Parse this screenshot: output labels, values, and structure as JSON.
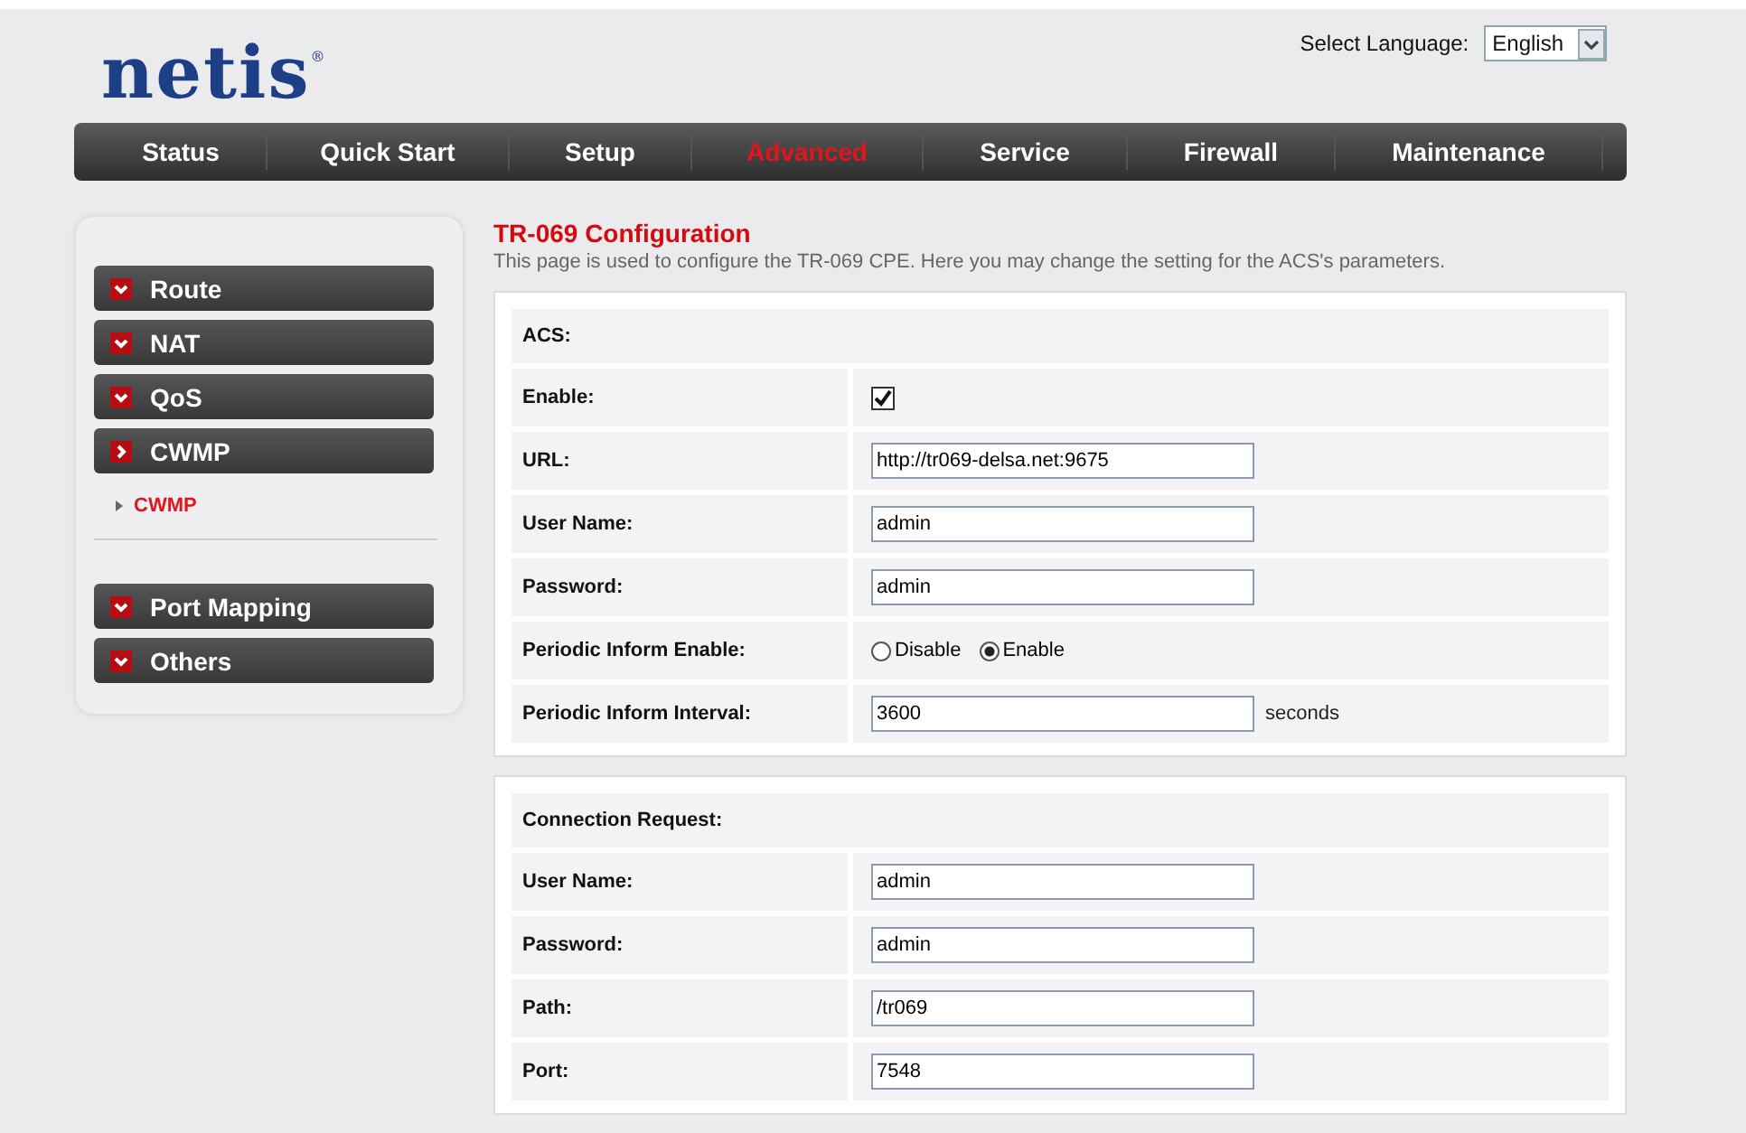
{
  "logo": "netis",
  "logo_mark": "®",
  "language": {
    "label": "Select Language:",
    "value": "English"
  },
  "nav": [
    {
      "label": "Status",
      "selected": false
    },
    {
      "label": "Quick Start",
      "selected": false
    },
    {
      "label": "Setup",
      "selected": false
    },
    {
      "label": "Advanced",
      "selected": true
    },
    {
      "label": "Service",
      "selected": false
    },
    {
      "label": "Firewall",
      "selected": false
    },
    {
      "label": "Maintenance",
      "selected": false
    }
  ],
  "sidebar": {
    "groups": [
      [
        {
          "label": "Route",
          "expanded": false
        },
        {
          "label": "NAT",
          "expanded": false
        },
        {
          "label": "QoS",
          "expanded": false
        },
        {
          "label": "CWMP",
          "expanded": true,
          "children": [
            {
              "label": "CWMP",
              "selected": true
            }
          ]
        }
      ],
      [
        {
          "label": "Port Mapping",
          "expanded": false
        },
        {
          "label": "Others",
          "expanded": false
        }
      ]
    ]
  },
  "title": "TR-069 Configuration",
  "description": "This page is used to configure the TR-069 CPE. Here you may change the setting for the ACS's parameters.",
  "sections": [
    {
      "heading": "ACS:",
      "rows": [
        {
          "kind": "checkbox",
          "label": "Enable:",
          "checked": true
        },
        {
          "kind": "text",
          "label": "URL:",
          "value": "http://tr069-delsa.net:9675"
        },
        {
          "kind": "text",
          "label": "User Name:",
          "value": "admin"
        },
        {
          "kind": "text",
          "label": "Password:",
          "value": "admin"
        },
        {
          "kind": "radio",
          "label": "Periodic Inform Enable:",
          "options": [
            {
              "label": "Disable",
              "selected": false
            },
            {
              "label": "Enable",
              "selected": true
            }
          ]
        },
        {
          "kind": "text",
          "label": "Periodic Inform Interval:",
          "value": "3600",
          "unit": "seconds"
        }
      ]
    },
    {
      "heading": "Connection Request:",
      "rows": [
        {
          "kind": "text",
          "label": "User Name:",
          "value": "admin"
        },
        {
          "kind": "text",
          "label": "Password:",
          "value": "admin"
        },
        {
          "kind": "text",
          "label": "Path:",
          "value": "/tr069"
        },
        {
          "kind": "text",
          "label": "Port:",
          "value": "7548"
        }
      ]
    }
  ]
}
